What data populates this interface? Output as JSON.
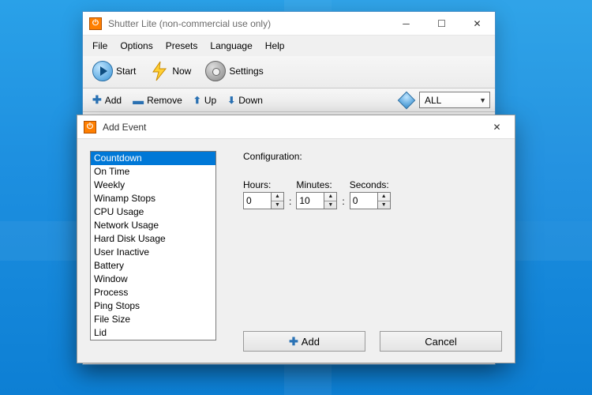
{
  "main": {
    "title": "Shutter Lite (non-commercial use only)",
    "menu": {
      "file": "File",
      "options": "Options",
      "presets": "Presets",
      "language": "Language",
      "help": "Help"
    },
    "toolbar": {
      "start": "Start",
      "now": "Now",
      "settings": "Settings"
    },
    "subtoolbar": {
      "add": "Add",
      "remove": "Remove",
      "up": "Up",
      "down": "Down",
      "filter_value": "ALL"
    }
  },
  "dialog": {
    "title": "Add Event",
    "events": [
      "Countdown",
      "On Time",
      "Weekly",
      "Winamp Stops",
      "CPU Usage",
      "Network Usage",
      "Hard Disk Usage",
      "User Inactive",
      "Battery",
      "Window",
      "Process",
      "Ping Stops",
      "File Size",
      "Lid"
    ],
    "selected_index": 0,
    "config_label": "Configuration:",
    "fields": {
      "hours": {
        "label": "Hours:",
        "value": "0"
      },
      "minutes": {
        "label": "Minutes:",
        "value": "10"
      },
      "seconds": {
        "label": "Seconds:",
        "value": "0"
      }
    },
    "buttons": {
      "add": "Add",
      "cancel": "Cancel"
    }
  }
}
